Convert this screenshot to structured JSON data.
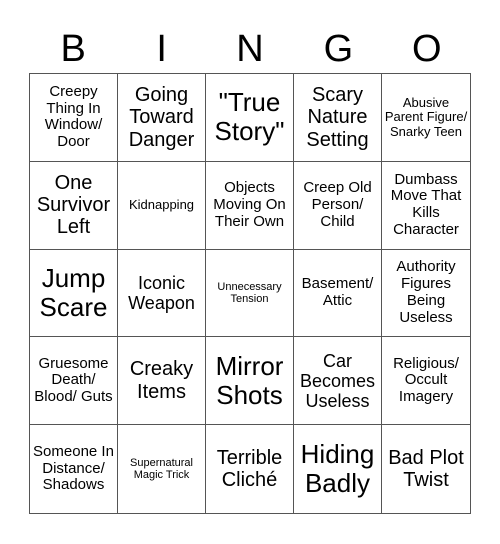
{
  "header": [
    "B",
    "I",
    "N",
    "G",
    "O"
  ],
  "cells": [
    {
      "text": "Creepy Thing In Window/ Door",
      "size": "s-md"
    },
    {
      "text": "Going Toward Danger",
      "size": "s-xl"
    },
    {
      "text": "\"True Story\"",
      "size": "s-xxl"
    },
    {
      "text": "Scary Nature Setting",
      "size": "s-xl"
    },
    {
      "text": "Abusive Parent Figure/ Snarky Teen",
      "size": "s-sm"
    },
    {
      "text": "One Survivor Left",
      "size": "s-xl"
    },
    {
      "text": "Kidnapping",
      "size": "s-sm"
    },
    {
      "text": "Objects Moving On Their Own",
      "size": "s-md"
    },
    {
      "text": "Creep Old Person/ Child",
      "size": "s-md"
    },
    {
      "text": "Dumbass Move That Kills Character",
      "size": "s-md"
    },
    {
      "text": "Jump Scare",
      "size": "s-xxl"
    },
    {
      "text": "Iconic Weapon",
      "size": "s-lg"
    },
    {
      "text": "Unnecessary Tension",
      "size": "s-xs"
    },
    {
      "text": "Basement/ Attic",
      "size": "s-md"
    },
    {
      "text": "Authority Figures Being Useless",
      "size": "s-md"
    },
    {
      "text": "Gruesome Death/ Blood/ Guts",
      "size": "s-md"
    },
    {
      "text": "Creaky Items",
      "size": "s-xl"
    },
    {
      "text": "Mirror Shots",
      "size": "s-xxl"
    },
    {
      "text": "Car Becomes Useless",
      "size": "s-lg"
    },
    {
      "text": "Religious/ Occult Imagery",
      "size": "s-md"
    },
    {
      "text": "Someone In Distance/ Shadows",
      "size": "s-md"
    },
    {
      "text": "Supernatural Magic Trick",
      "size": "s-xs"
    },
    {
      "text": "Terrible Cliché",
      "size": "s-xl"
    },
    {
      "text": "Hiding Badly",
      "size": "s-xxl"
    },
    {
      "text": "Bad Plot Twist",
      "size": "s-xl"
    }
  ]
}
